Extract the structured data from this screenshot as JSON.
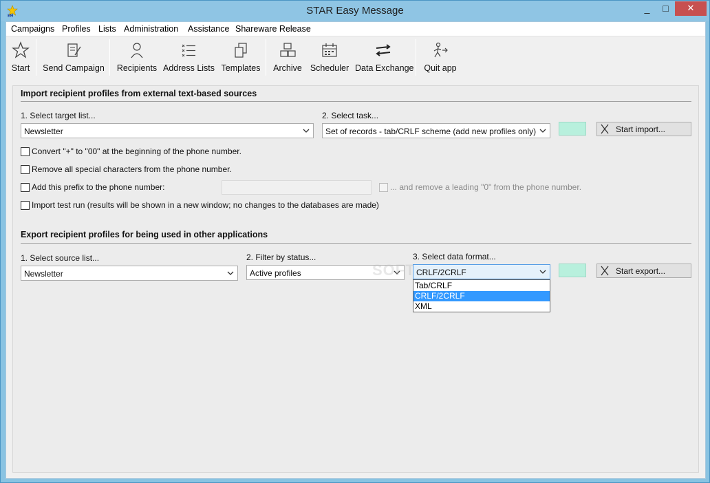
{
  "window": {
    "title": "STAR Easy Message",
    "min": "_",
    "max": "□",
    "close": "✕"
  },
  "menu": [
    "Campaigns",
    "Profiles",
    "Lists",
    "Administration",
    "Assistance",
    "Shareware Release"
  ],
  "toolbar": {
    "start": "Start",
    "send_campaign": "Send Campaign",
    "recipients": "Recipients",
    "address_lists": "Address Lists",
    "templates": "Templates",
    "archive": "Archive",
    "scheduler": "Scheduler",
    "data_exchange": "Data Exchange",
    "quit_app": "Quit app"
  },
  "import": {
    "title": "Import recipient profiles from external text-based sources",
    "target_label": "1. Select target list...",
    "target_value": "Newsletter",
    "task_label": "2. Select task...",
    "task_value": "Set of records - tab/CRLF scheme (add new profiles only)",
    "start_button": "Start import...",
    "opt_convert": "Convert \"+\" to \"00\" at the beginning of the phone number.",
    "opt_remove": "Remove all special characters from the phone number.",
    "opt_prefix": "Add this prefix to the phone number:",
    "opt_prefix_value": "",
    "opt_leading_zero": "... and remove a leading \"0\" from the phone number.",
    "opt_test_run": "Import test run (results will be shown in a new window; no changes to the databases are made)"
  },
  "export": {
    "title": "Export recipient profiles for being used in other applications",
    "source_label": "1. Select source list...",
    "source_value": "Newsletter",
    "filter_label": "2. Filter by status...",
    "filter_value": "Active profiles",
    "format_label": "3. Select data format...",
    "format_value": "CRLF/2CRLF",
    "format_options": [
      "Tab/CRLF",
      "CRLF/2CRLF",
      "XML"
    ],
    "start_button": "Start export..."
  },
  "watermark": "SOFTPEDIA",
  "colors": {
    "accent_swatch": "#b8f0dd",
    "selected_item": "#3399ff",
    "close_button": "#c75050"
  }
}
